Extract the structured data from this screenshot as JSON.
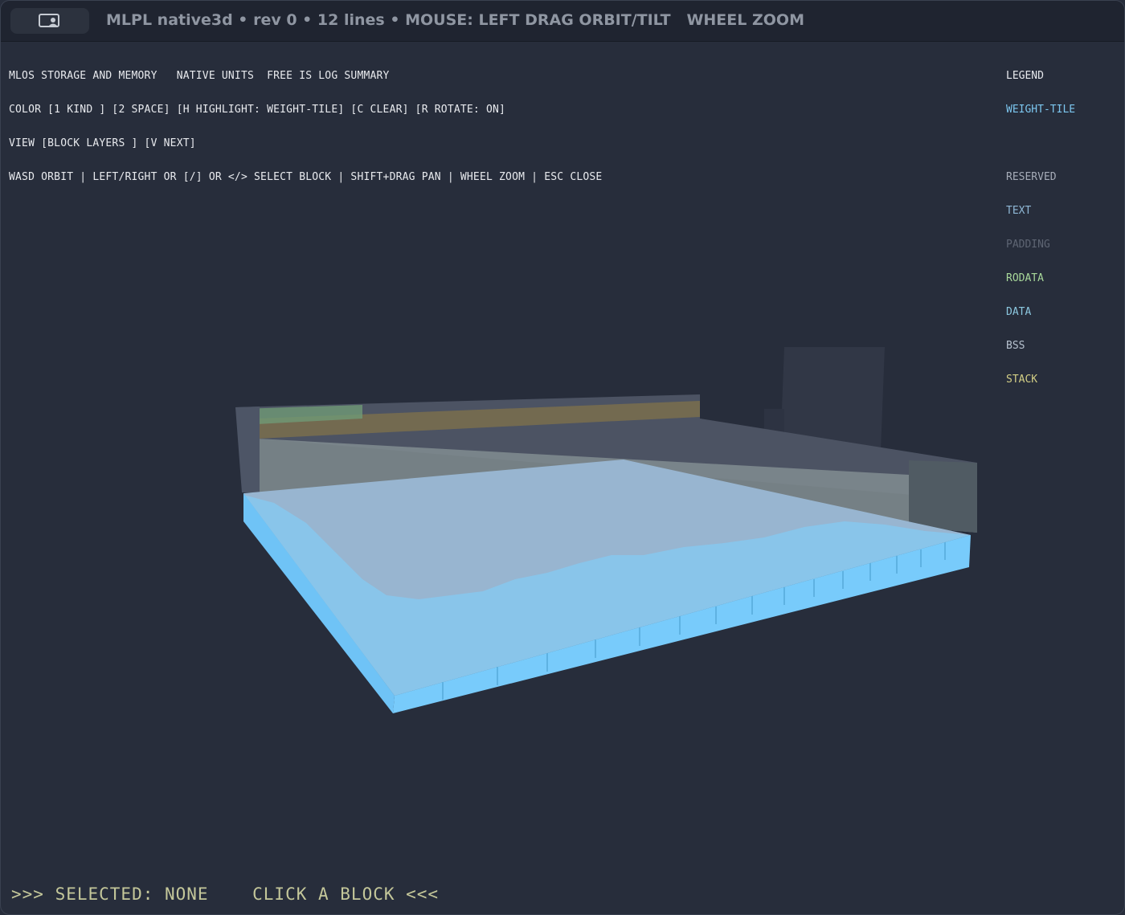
{
  "window": {
    "title": "MLPL native3d • rev 0 • 12 lines • MOUSE: LEFT DRAG ORBIT/TILT   WHEEL ZOOM"
  },
  "hud": {
    "lines": [
      "MLOS STORAGE AND MEMORY   NATIVE UNITS  FREE IS LOG SUMMARY",
      "COLOR [1 KIND ] [2 SPACE] [H HIGHLIGHT: WEIGHT-TILE] [C CLEAR] [R ROTATE: ON]",
      "VIEW [BLOCK LAYERS ] [V NEXT]",
      "WASD ORBIT | LEFT/RIGHT OR [/] OR </> SELECT BLOCK | SHIFT+DRAG PAN | WHEEL ZOOM | ESC CLOSE"
    ]
  },
  "legend": {
    "heading": "LEGEND",
    "highlight": {
      "label": "WEIGHT-TILE",
      "color": "#7cc6ef"
    },
    "items": [
      {
        "label": "RESERVED",
        "color": "#a6acb8"
      },
      {
        "label": "TEXT",
        "color": "#8fb8d6"
      },
      {
        "label": "PADDING",
        "color": "#5e6573"
      },
      {
        "label": "RODATA",
        "color": "#a8d89a"
      },
      {
        "label": "DATA",
        "color": "#8cc8e0"
      },
      {
        "label": "BSS",
        "color": "#b7c2cf"
      },
      {
        "label": "STACK",
        "color": "#d3cf86"
      }
    ]
  },
  "status": {
    "text": ">>> SELECTED: NONE    CLICK A BLOCK <<<"
  },
  "colors": {
    "background": "#272d3b",
    "weight_tile": "#76cbfb"
  },
  "icons": {
    "title_button": "screen-user-icon"
  }
}
